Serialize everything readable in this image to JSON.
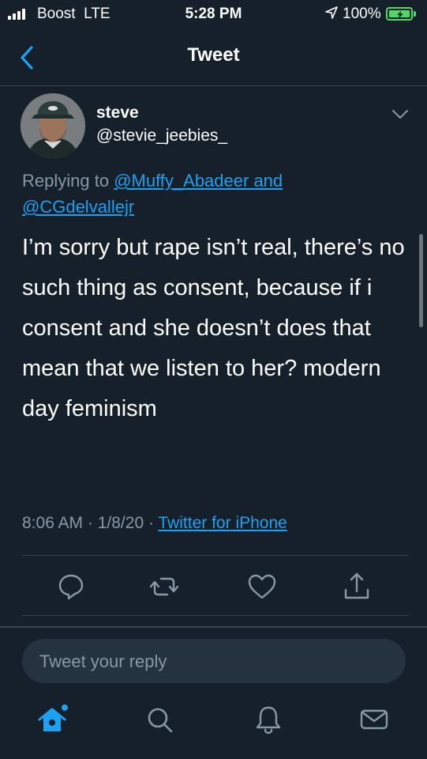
{
  "status_bar": {
    "carrier": "Boost",
    "network": "LTE",
    "time": "5:28 PM",
    "battery": "100%",
    "battery_level": 1.0,
    "signal_bars": 4
  },
  "nav": {
    "title": "Tweet",
    "back_icon": "chevron-left-icon"
  },
  "tweet": {
    "author_name": "steve",
    "author_handle": "@stevie_jeebies_",
    "replying_prefix": "Replying to ",
    "replying_user_1": "@Muffy_Abadeer",
    "replying_and": " and",
    "replying_user_2": "@CGdelvallejr",
    "text": "I’m sorry but rape isn’t real, there’s no such thing as consent, because if i consent and she doesn’t does that mean that we listen to her? modern day feminism",
    "time": "8:06 AM",
    "sep": " · ",
    "date": "1/8/20",
    "source": "Twitter for iPhone"
  },
  "actions": [
    "reply-icon",
    "retweet-icon",
    "like-icon",
    "share-icon"
  ],
  "reply_input": {
    "placeholder": "Tweet your reply",
    "value": ""
  },
  "tab_bar": [
    "home-icon",
    "search-icon",
    "notifications-icon",
    "messages-icon"
  ],
  "colors": {
    "background": "#15202b",
    "accent": "#1da1f2",
    "muted": "#8899a6",
    "divider": "#38444d",
    "battery": "#4cd964"
  }
}
